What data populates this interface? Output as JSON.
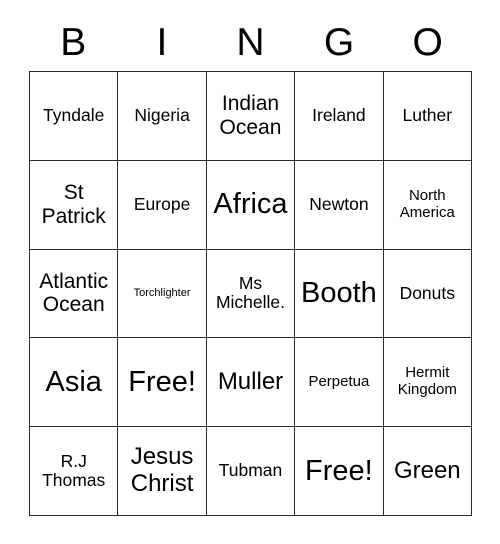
{
  "card": {
    "title_letters": [
      "B",
      "I",
      "N",
      "G",
      "O"
    ],
    "colors": {
      "background": "#ffffff",
      "text": "#000000",
      "grid_line": "#2b2b2b"
    },
    "rows": [
      [
        {
          "text": "Tyndale",
          "size": "m"
        },
        {
          "text": "Nigeria",
          "size": "m"
        },
        {
          "text": "Indian\nOcean",
          "size": "l"
        },
        {
          "text": "Ireland",
          "size": "m"
        },
        {
          "text": "Luther",
          "size": "m"
        }
      ],
      [
        {
          "text": "St\nPatrick",
          "size": "l"
        },
        {
          "text": "Europe",
          "size": "m"
        },
        {
          "text": "Africa",
          "size": "xxl"
        },
        {
          "text": "Newton",
          "size": "m"
        },
        {
          "text": "North\nAmerica",
          "size": "s"
        }
      ],
      [
        {
          "text": "Atlantic\nOcean",
          "size": "l"
        },
        {
          "text": "Torchlighter",
          "size": "xs"
        },
        {
          "text": "Ms\nMichelle.",
          "size": "m"
        },
        {
          "text": "Booth",
          "size": "xxl"
        },
        {
          "text": "Donuts",
          "size": "m"
        }
      ],
      [
        {
          "text": "Asia",
          "size": "xxl"
        },
        {
          "text": "Free!",
          "size": "xxl"
        },
        {
          "text": "Muller",
          "size": "xl"
        },
        {
          "text": "Perpetua",
          "size": "s"
        },
        {
          "text": "Hermit\nKingdom",
          "size": "s"
        }
      ],
      [
        {
          "text": "R.J\nThomas",
          "size": "m"
        },
        {
          "text": "Jesus\nChrist",
          "size": "xl"
        },
        {
          "text": "Tubman",
          "size": "m"
        },
        {
          "text": "Free!",
          "size": "xxl"
        },
        {
          "text": "Green",
          "size": "xl"
        }
      ]
    ]
  }
}
